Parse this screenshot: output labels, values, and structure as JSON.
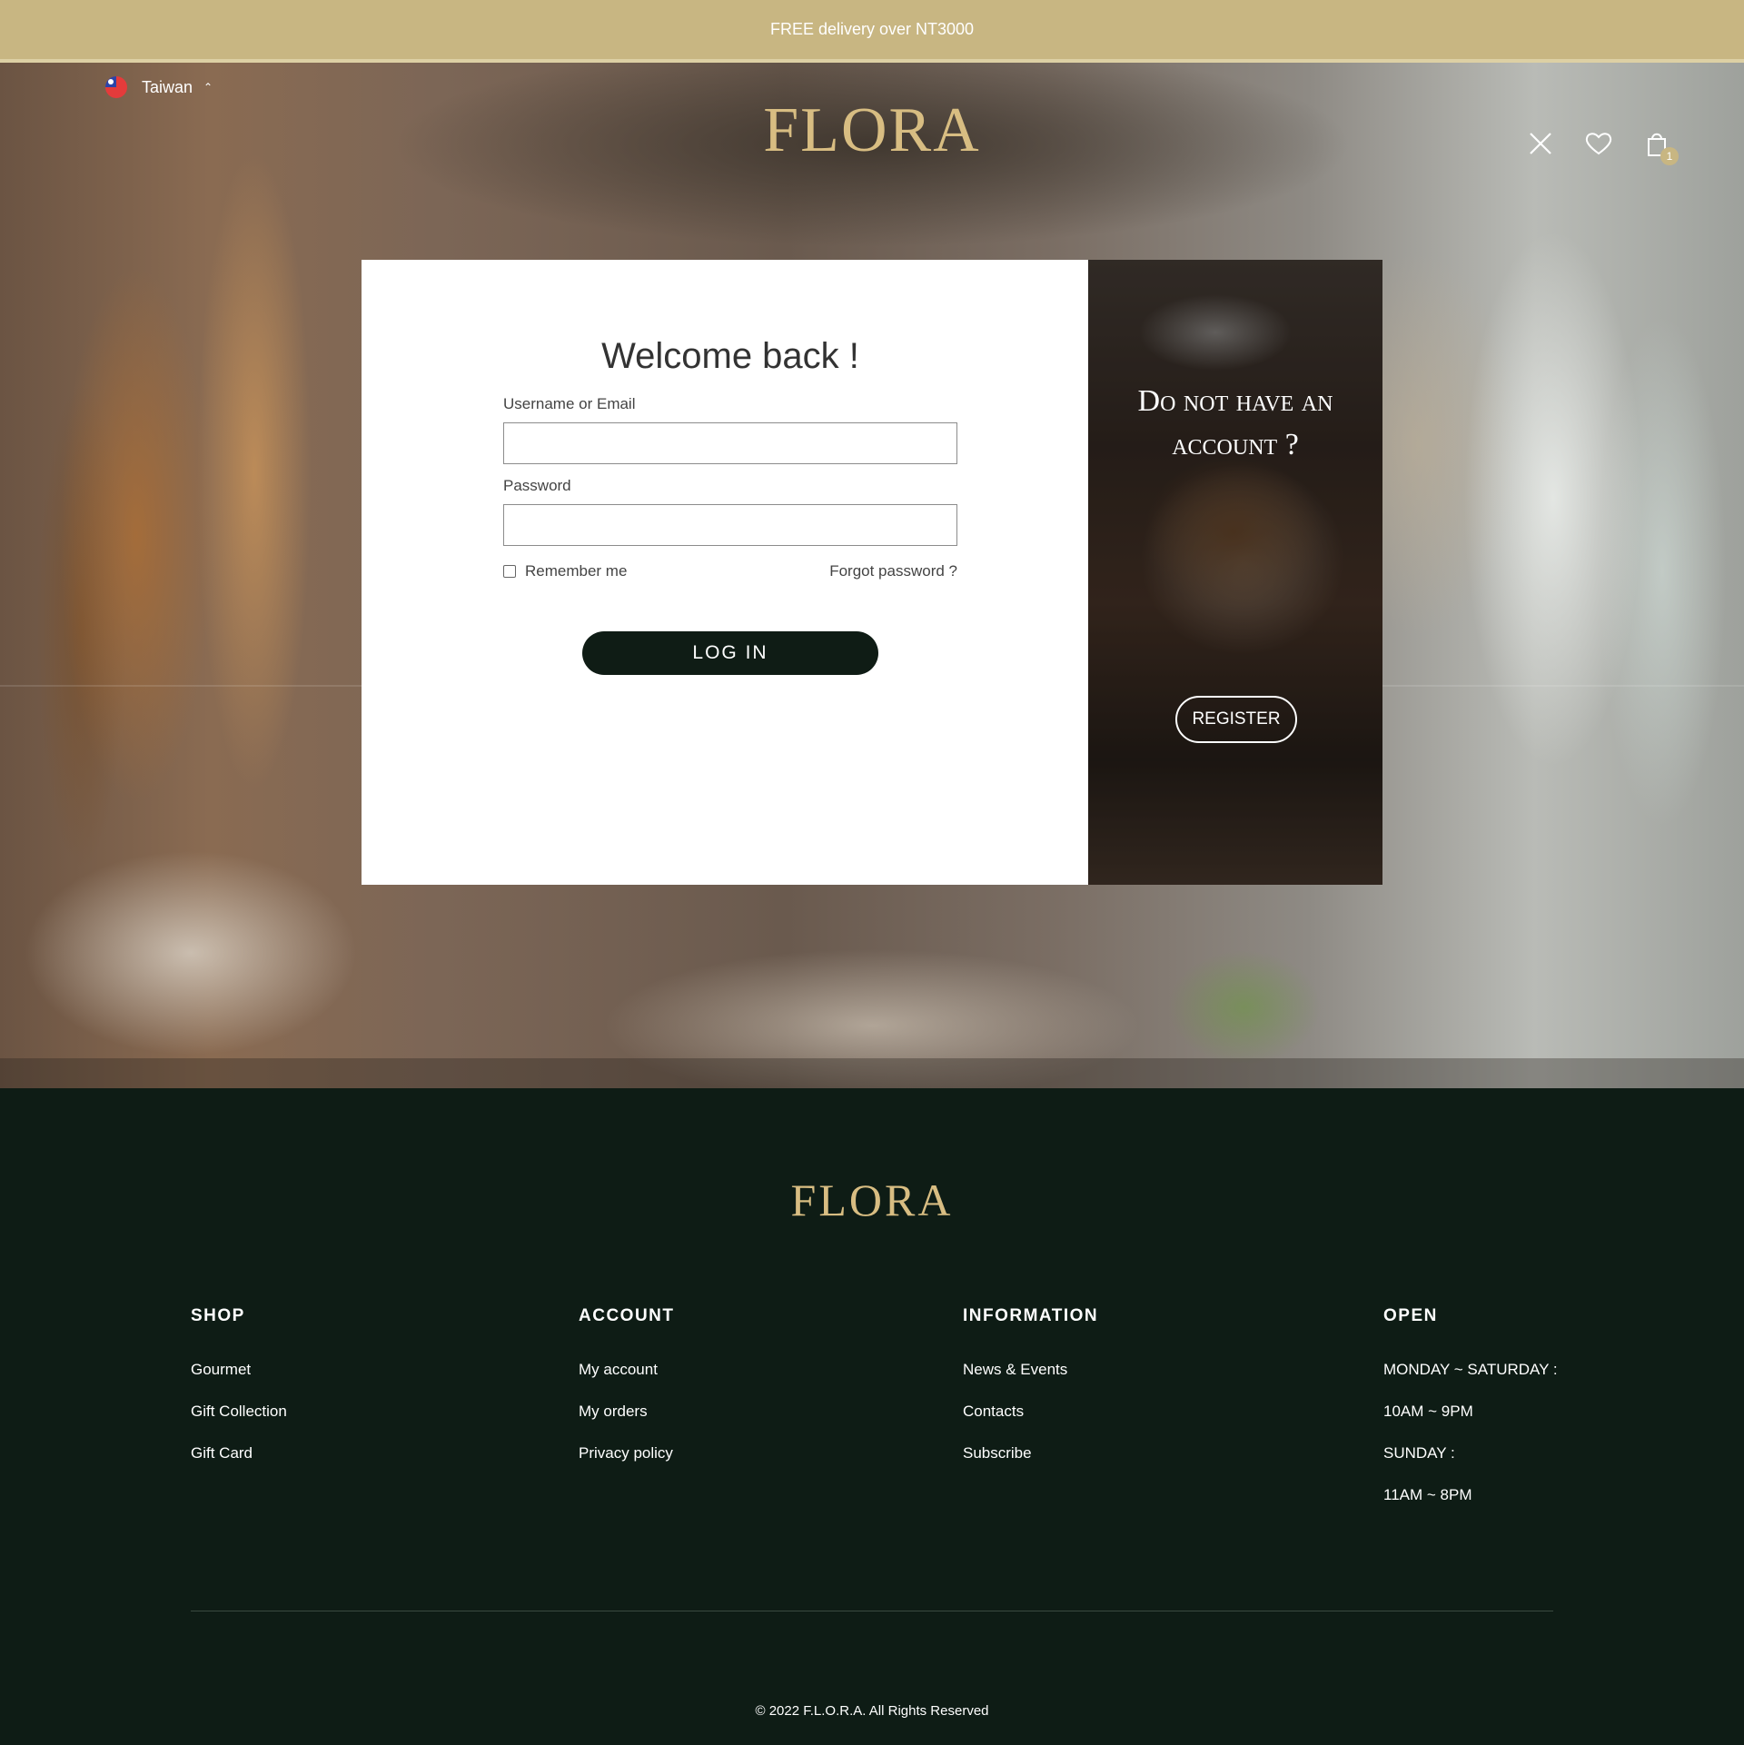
{
  "announcement": {
    "text": "FREE delivery over NT3000"
  },
  "header": {
    "region": "Taiwan",
    "logo": "FLORA",
    "cart_count": "1"
  },
  "login": {
    "title": "Welcome back !",
    "username_label": "Username or Email",
    "username_value": "",
    "password_label": "Password",
    "password_value": "",
    "remember_label": "Remember me",
    "forgot_label": "Forgot password ?",
    "submit_label": "LOG IN"
  },
  "register_panel": {
    "title": "Do not have an account ?",
    "button_label": "REGISTER"
  },
  "footer": {
    "logo": "FLORA",
    "columns": [
      {
        "title": "SHOP",
        "items": [
          "Gourmet",
          "Gift Collection",
          "Gift Card"
        ]
      },
      {
        "title": "ACCOUNT",
        "items": [
          "My account",
          "My orders",
          "Privacy policy"
        ]
      },
      {
        "title": "INFORMATION",
        "items": [
          "News & Events",
          "Contacts",
          "Subscribe"
        ]
      },
      {
        "title": "OPEN",
        "items": [
          "MONDAY ~ SATURDAY :",
          "10AM ~ 9PM",
          "SUNDAY :",
          "11AM ~ 8PM"
        ]
      }
    ],
    "copyright": "© 2022 F.L.O.R.A. All Rights Reserved"
  },
  "colors": {
    "announcement_bg": "#c8b682",
    "brand_gold": "#d8bd82",
    "dark_green": "#0e1c15"
  }
}
